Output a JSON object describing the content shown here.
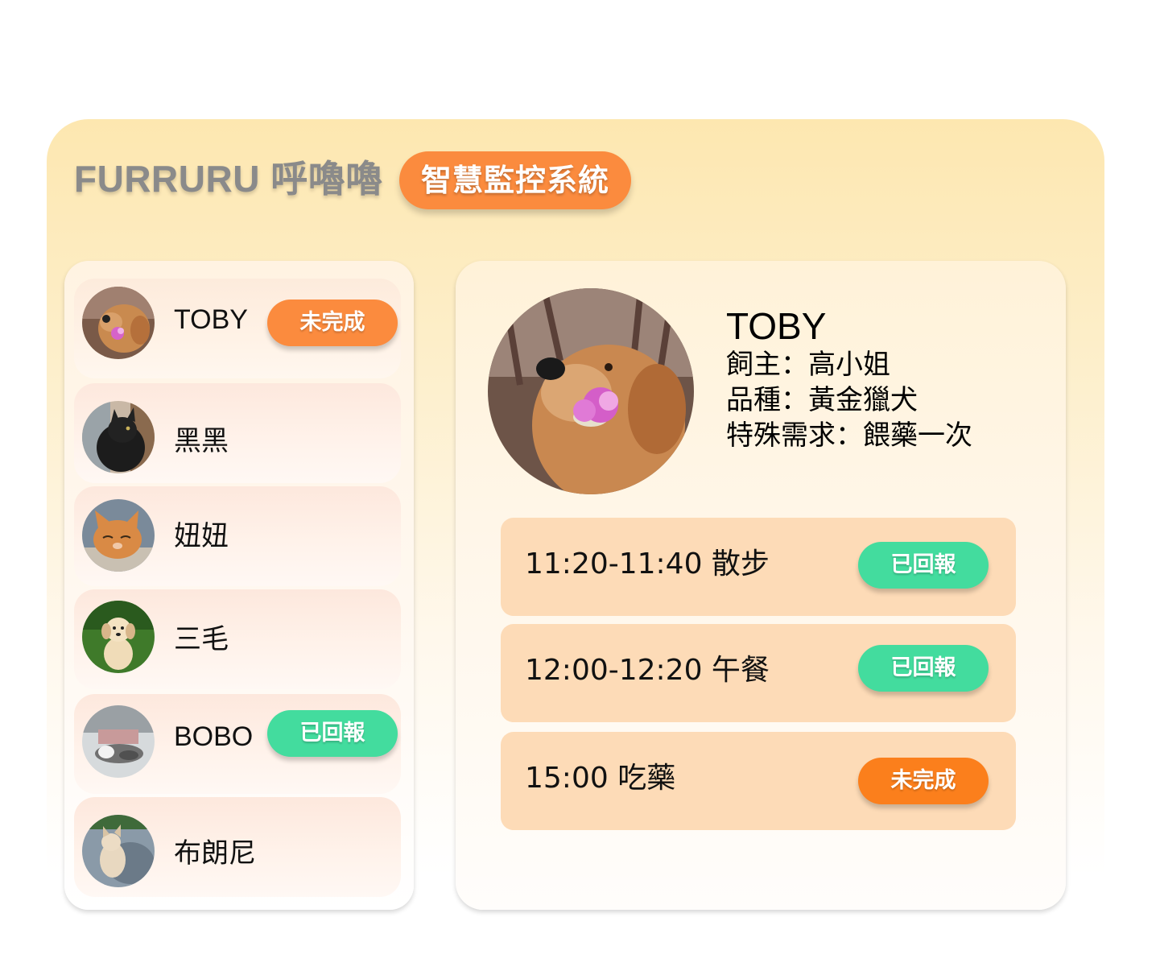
{
  "header": {
    "brand": "FURRURU 呼嚕嚕",
    "system_badge": "智慧監控系統"
  },
  "pets": [
    {
      "name": "TOBY",
      "status": "未完成",
      "status_color": "#fb8b3e",
      "avatar": "golden-retriever-icon"
    },
    {
      "name": "黑黑",
      "status": "",
      "avatar": "black-cat-icon"
    },
    {
      "name": "妞妞",
      "status": "",
      "avatar": "orange-cat-icon"
    },
    {
      "name": "三毛",
      "status": "",
      "avatar": "puppy-icon"
    },
    {
      "name": "BOBO",
      "status": "已回報",
      "status_color": "#43dc9e",
      "avatar": "sleeping-cat-icon"
    },
    {
      "name": "布朗尼",
      "status": "",
      "avatar": "kitten-icon"
    }
  ],
  "detail": {
    "name": "TOBY",
    "owner": "飼主：高小姐",
    "breed": "品種：黃金獵犬",
    "special": "特殊需求：餵藥一次"
  },
  "tasks": [
    {
      "text": "11:20-11:40 散步",
      "status": "已回報",
      "status_color": "#43dc9e"
    },
    {
      "text": "12:00-12:20 午餐",
      "status": "已回報",
      "status_color": "#43dc9e"
    },
    {
      "text": "15:00 吃藥",
      "status": "未完成",
      "status_color": "#fb7f1c"
    }
  ],
  "colors": {
    "accent_orange": "#fb8b3e",
    "success_green": "#43dc9e",
    "task_bg": "#fddbb7"
  }
}
